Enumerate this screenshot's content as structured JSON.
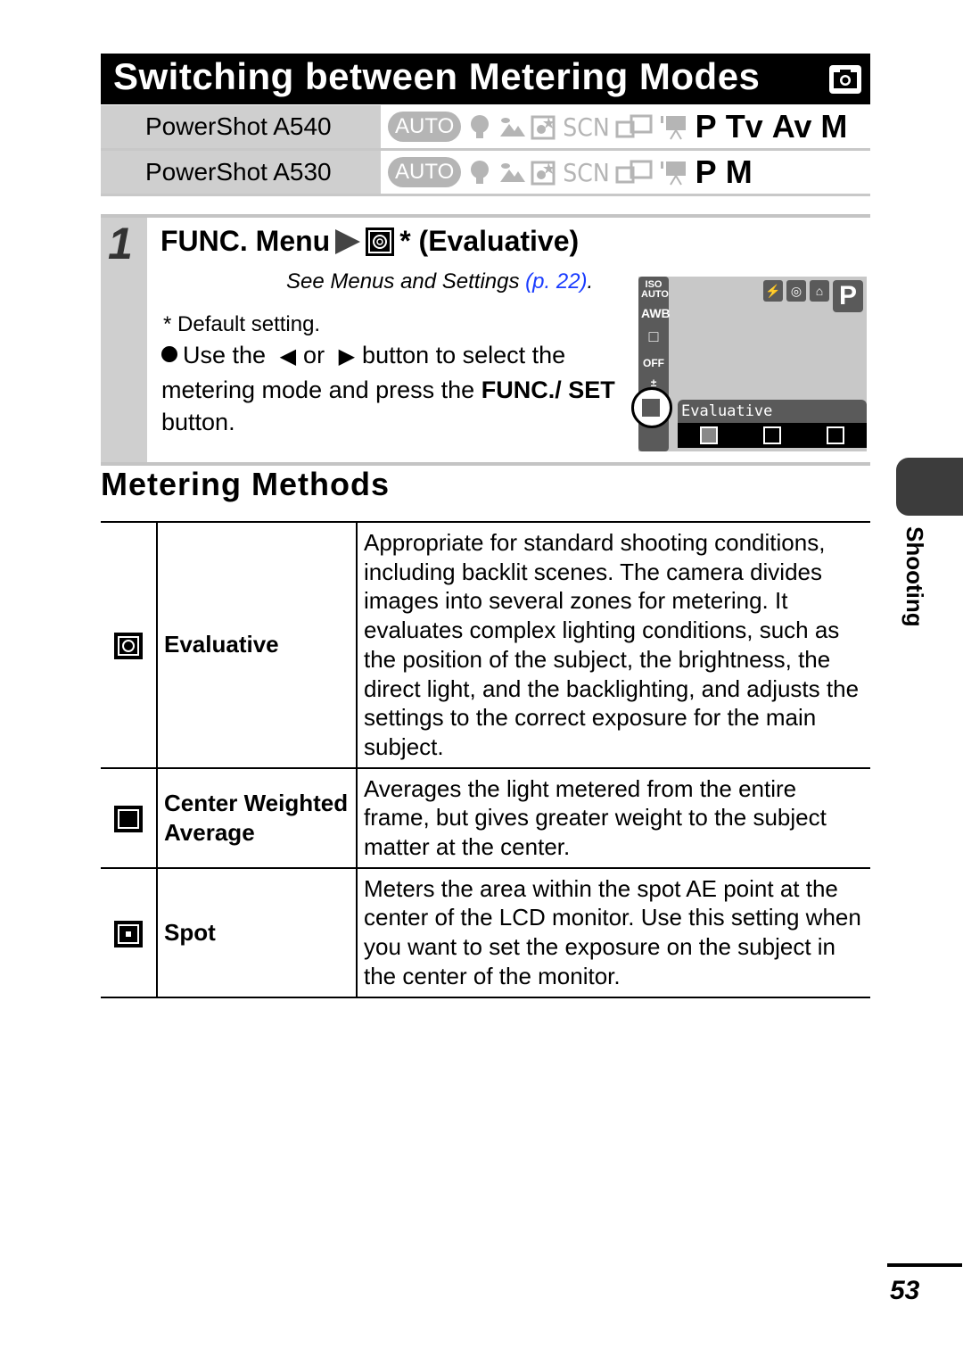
{
  "title": "Switching between Metering Modes",
  "title_icon": "camera-icon",
  "models": [
    {
      "label": "PowerShot A540",
      "inactive_modes": [
        "AUTO",
        "portrait",
        "landscape",
        "night-scene",
        "SCN",
        "stitch-assist",
        "movie"
      ],
      "active_modes": [
        "P",
        "Tv",
        "Av",
        "M"
      ]
    },
    {
      "label": "PowerShot A530",
      "inactive_modes": [
        "AUTO",
        "portrait",
        "landscape",
        "night-scene",
        "SCN",
        "stitch-assist",
        "movie"
      ],
      "active_modes": [
        "P",
        "M"
      ]
    }
  ],
  "step": {
    "number": "1",
    "heading_prefix": "FUNC. Menu",
    "heading_suffix": "* (Evaluative)",
    "see_ref_text": "See Menus and Settings ",
    "see_ref_link": "(p. 22)",
    "see_ref_end": ".",
    "default_note": "* Default setting.",
    "bullet": {
      "part1": "Use the",
      "left_arrow": "🡄",
      "or": "or",
      "right_arrow": "🡆",
      "part2": "button to select the metering mode and press the",
      "bold1": "FUNC./ SET",
      "part3": "button."
    }
  },
  "lcd": {
    "sidebar_items": [
      "ISO AUTO",
      "AWB",
      "□",
      "OFF",
      "±"
    ],
    "top_icons": [
      "flash-off",
      "red-eye",
      "self-timer"
    ],
    "mode": "P",
    "selected_label": "Evaluative",
    "options": [
      "evaluative",
      "center-weighted",
      "spot"
    ]
  },
  "section_heading": "Metering Methods",
  "methods": [
    {
      "icon": "evaluative-metering-icon",
      "name": "Evaluative",
      "description": "Appropriate for standard shooting conditions, including backlit scenes. The camera divides images into several zones for metering. It evaluates complex lighting conditions, such as the position of the subject, the brightness, the direct light, and the backlighting, and adjusts the settings to the correct exposure for the main subject."
    },
    {
      "icon": "center-weighted-metering-icon",
      "name": "Center Weighted Average",
      "description": "Averages the light metered from the entire frame, but gives greater weight to the subject matter at the center."
    },
    {
      "icon": "spot-metering-icon",
      "name": "Spot",
      "description": "Meters the area within the spot AE point at the center of the LCD monitor. Use this setting when you want to set the exposure on the subject in the center of the monitor."
    }
  ],
  "side_tab": "Shooting",
  "page_number": "53"
}
